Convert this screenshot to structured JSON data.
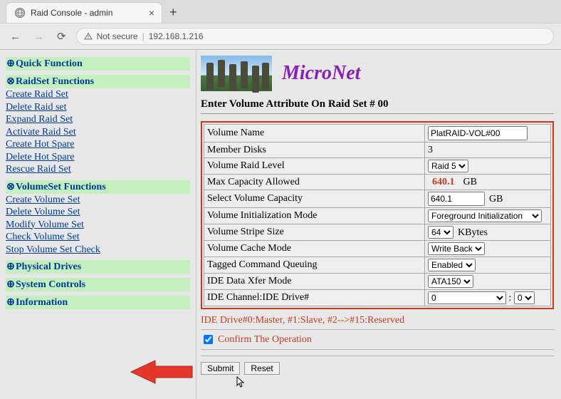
{
  "browser": {
    "tab_title": "Raid Console - admin",
    "not_secure": "Not secure",
    "url": "192.168.1.216"
  },
  "brand": "MicroNet",
  "form_title": "Enter Volume Attribute On Raid Set # 00",
  "sidebar": {
    "sections": [
      {
        "icon": "⊕",
        "title": "Quick Function",
        "links": []
      },
      {
        "icon": "⊗",
        "title": "RaidSet Functions",
        "links": [
          "Create Raid Set",
          "Delete Raid set",
          "Expand Raid Set",
          "Activate Raid Set",
          "Create Hot Spare",
          "Delete Hot Spare",
          "Rescue Raid Set"
        ]
      },
      {
        "icon": "⊗",
        "title": "VolumeSet Functions",
        "links": [
          "Create Volume Set",
          "Delete Volume Set",
          "Modify Volume Set",
          "Check Volume Set",
          "Stop Volume Set Check"
        ]
      },
      {
        "icon": "⊕",
        "title": "Physical Drives",
        "links": []
      },
      {
        "icon": "⊕",
        "title": "System Controls",
        "links": []
      },
      {
        "icon": "⊕",
        "title": "Information",
        "links": []
      }
    ]
  },
  "rows": {
    "volume_name": {
      "label": "Volume Name",
      "value": "PlatRAID-VOL#00"
    },
    "member_disks": {
      "label": "Member Disks",
      "value": "3"
    },
    "raid_level": {
      "label": "Volume Raid Level",
      "value": "Raid 5"
    },
    "max_capacity": {
      "label": "Max Capacity Allowed",
      "value": "640.1",
      "unit": "GB"
    },
    "sel_capacity": {
      "label": "Select Volume Capacity",
      "value": "640.1",
      "unit": "GB"
    },
    "init_mode": {
      "label": "Volume Initialization Mode",
      "value": "Foreground Initialization"
    },
    "stripe": {
      "label": "Volume Stripe Size",
      "value": "64",
      "unit": "KBytes"
    },
    "cache": {
      "label": "Volume Cache Mode",
      "value": "Write Back"
    },
    "tcq": {
      "label": "Tagged Command Queuing",
      "value": "Enabled"
    },
    "xfer": {
      "label": "IDE Data Xfer Mode",
      "value": "ATA150"
    },
    "chan": {
      "label": "IDE Channel:IDE Drive#",
      "channel": "0",
      "sep": ":",
      "drive": "0"
    }
  },
  "note": "IDE Drive#0:Master, #1:Slave, #2-->#15:Reserved",
  "confirm_label": "Confirm The Operation",
  "buttons": {
    "submit": "Submit",
    "reset": "Reset"
  }
}
